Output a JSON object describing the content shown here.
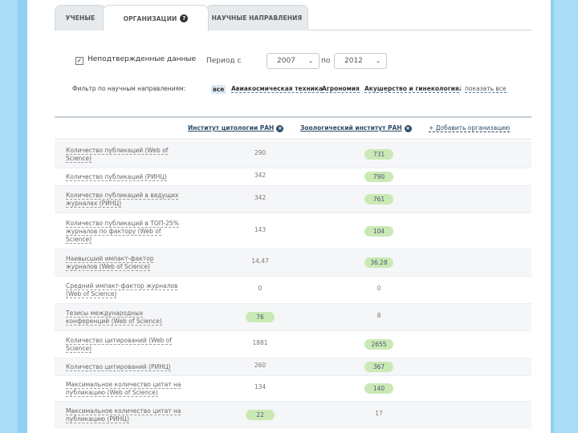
{
  "tabs": [
    {
      "label": "УЧЕНЫЕ"
    },
    {
      "label": "ОРГАНИЗАЦИИ",
      "badge": "?"
    },
    {
      "label": "НАУЧНЫЕ НАПРАВЛЕНИЯ"
    }
  ],
  "controls": {
    "checkbox_checked": true,
    "checkbox_mark": "✓",
    "checkbox_label": "Неподтвержденные данные",
    "period_label": "Период с",
    "from_value": "2007",
    "to_label": "по",
    "to_value": "2012",
    "chevron": "⌄"
  },
  "filter": {
    "label": "Фильтр по научным направлениям:",
    "all": "все",
    "items": [
      "Авиакосмическая техника",
      "Агрономия",
      "Акушерство и гинекология"
    ],
    "more_icon": "↓",
    "show_all": "показать все"
  },
  "table": {
    "orgs": [
      {
        "name": "Институт цитологии РАН",
        "remove": "×"
      },
      {
        "name": "Зоологический институт РАН",
        "remove": "×"
      }
    ],
    "add_org": "+ Добавить организацию",
    "rows": [
      {
        "label": "Количество публикаций (Web of Science)",
        "v1": "290",
        "v2": "731",
        "hl": 2
      },
      {
        "label": "Количество публикаций (РИНЦ)",
        "v1": "342",
        "v2": "790",
        "hl": 2
      },
      {
        "label": "Количество публикаций в ведущих журналах (РИНЦ)",
        "v1": "342",
        "v2": "761",
        "hl": 2
      },
      {
        "label": "Количество публикаций в ТОП-25% журналов по фактору (Web of Science)",
        "v1": "143",
        "v2": "104",
        "hl": 2
      },
      {
        "label": "Наивысший импакт-фактор журналов (Web of Science)",
        "v1": "14,47",
        "v2": "36,28",
        "hl": 2
      },
      {
        "label": "Средний импакт-фактор журналов (Web of Science)",
        "v1": "0",
        "v2": "0",
        "hl": 0
      },
      {
        "label": "Тезисы международных конференций (Web of Science)",
        "v1": "76",
        "v2": "8",
        "hl": 1
      },
      {
        "label": "Количество цитирований (Web of Science)",
        "v1": "1881",
        "v2": "2655",
        "hl": 2
      },
      {
        "label": "Количество цитирований (РИНЦ)",
        "v1": "260",
        "v2": "367",
        "hl": 2
      },
      {
        "label": "Максимальное количество цитат на публикацию (Web of Science)",
        "v1": "134",
        "v2": "140",
        "hl": 2
      },
      {
        "label": "Максимальное количество цитат на публикацию (РИНЦ)",
        "v1": "22",
        "v2": "17",
        "hl": 1
      }
    ]
  }
}
